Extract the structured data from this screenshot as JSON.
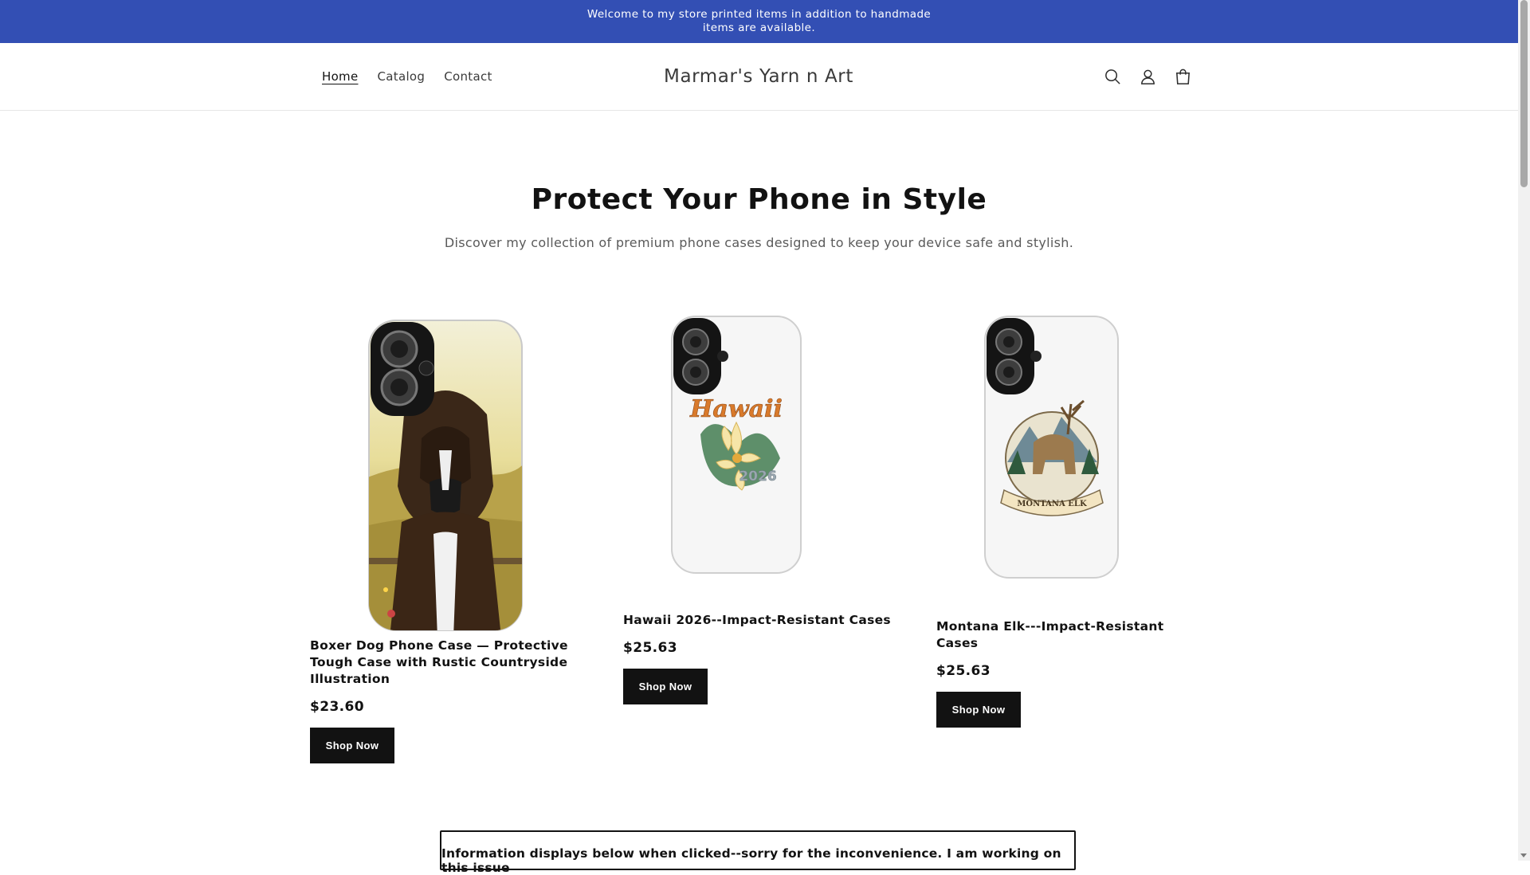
{
  "announcement": {
    "text": "Welcome to my store printed items in addition to handmade items are available."
  },
  "header": {
    "nav": [
      {
        "label": "Home",
        "active": true
      },
      {
        "label": "Catalog",
        "active": false
      },
      {
        "label": "Contact",
        "active": false
      }
    ],
    "logo": "Marmar's Yarn n Art",
    "icons": [
      "search-icon",
      "account-icon",
      "cart-icon"
    ]
  },
  "hero": {
    "title": "Protect Your Phone in Style",
    "subtitle": "Discover my collection of premium phone cases designed to keep your device safe and stylish."
  },
  "products": [
    {
      "title": "Boxer Dog Phone Case — Protective Tough Case with Rustic Countryside Illustration",
      "price": "$23.60",
      "button": "Shop Now"
    },
    {
      "title": "Hawaii 2026--Impact-Resistant Cases",
      "price": "$25.63",
      "button": "Shop Now",
      "art_text": "Hawaii",
      "art_year": "2026"
    },
    {
      "title": "Montana Elk---Impact-Resistant Cases",
      "price": "$25.63",
      "button": "Shop Now",
      "art_text": "MONTANA ELK"
    }
  ],
  "notice": {
    "text": "Information displays below when clicked--sorry for the inconvenience. I am working on this issue"
  },
  "colors": {
    "announcement_bg": "#334fb4",
    "button_bg": "#121212",
    "text": "#121212"
  }
}
